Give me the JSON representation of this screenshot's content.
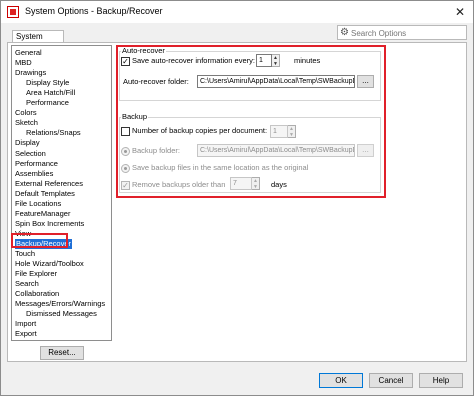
{
  "window": {
    "title": "System Options - Backup/Recover"
  },
  "search": {
    "placeholder": "Search Options"
  },
  "tabs": [
    {
      "label": "System Options"
    }
  ],
  "tree": {
    "items": [
      {
        "label": "General",
        "child": false
      },
      {
        "label": "MBD",
        "child": false
      },
      {
        "label": "Drawings",
        "child": false
      },
      {
        "label": "Display Style",
        "child": true
      },
      {
        "label": "Area Hatch/Fill",
        "child": true
      },
      {
        "label": "Performance",
        "child": true
      },
      {
        "label": "Colors",
        "child": false
      },
      {
        "label": "Sketch",
        "child": false
      },
      {
        "label": "Relations/Snaps",
        "child": true
      },
      {
        "label": "Display",
        "child": false
      },
      {
        "label": "Selection",
        "child": false
      },
      {
        "label": "Performance",
        "child": false
      },
      {
        "label": "Assemblies",
        "child": false
      },
      {
        "label": "External References",
        "child": false
      },
      {
        "label": "Default Templates",
        "child": false
      },
      {
        "label": "File Locations",
        "child": false
      },
      {
        "label": "FeatureManager",
        "child": false
      },
      {
        "label": "Spin Box Increments",
        "child": false
      },
      {
        "label": "View",
        "child": false
      },
      {
        "label": "Backup/Recover",
        "child": false,
        "selected": true
      },
      {
        "label": "Touch",
        "child": false
      },
      {
        "label": "Hole Wizard/Toolbox",
        "child": false
      },
      {
        "label": "File Explorer",
        "child": false
      },
      {
        "label": "Search",
        "child": false
      },
      {
        "label": "Collaboration",
        "child": false
      },
      {
        "label": "Messages/Errors/Warnings",
        "child": false
      },
      {
        "label": "Dismissed Messages",
        "child": true
      },
      {
        "label": "Import",
        "child": false
      },
      {
        "label": "Export",
        "child": false
      }
    ]
  },
  "reset_label": "Reset...",
  "auto_recover": {
    "group_label": "Auto-recover",
    "save_checked": true,
    "save_label": "Save auto-recover information every:",
    "save_interval": "1",
    "unit_label": "minutes",
    "folder_label": "Auto-recover folder:",
    "folder_value": "C:\\Users\\Amirul\\AppData\\Local\\Temp\\SWBackupDire",
    "browse_label": "..."
  },
  "backup": {
    "group_label": "Backup",
    "copies_checked": false,
    "copies_label": "Number of backup copies per document:",
    "copies_value": "1",
    "folder_label": "Backup folder:",
    "folder_value": "C:\\Users\\Amirul\\AppData\\Local\\Temp\\SWBackupDire",
    "browse_label": "...",
    "same_location_label": "Save backup files in the same location as the original",
    "remove_checked": true,
    "remove_label": "Remove backups older than",
    "remove_value": "7",
    "days_label": "days"
  },
  "footer": {
    "ok": "OK",
    "cancel": "Cancel",
    "help": "Help"
  },
  "icons": {
    "app": "solidworks-app-icon",
    "close": "close-icon",
    "search": "gear-search-icon"
  }
}
